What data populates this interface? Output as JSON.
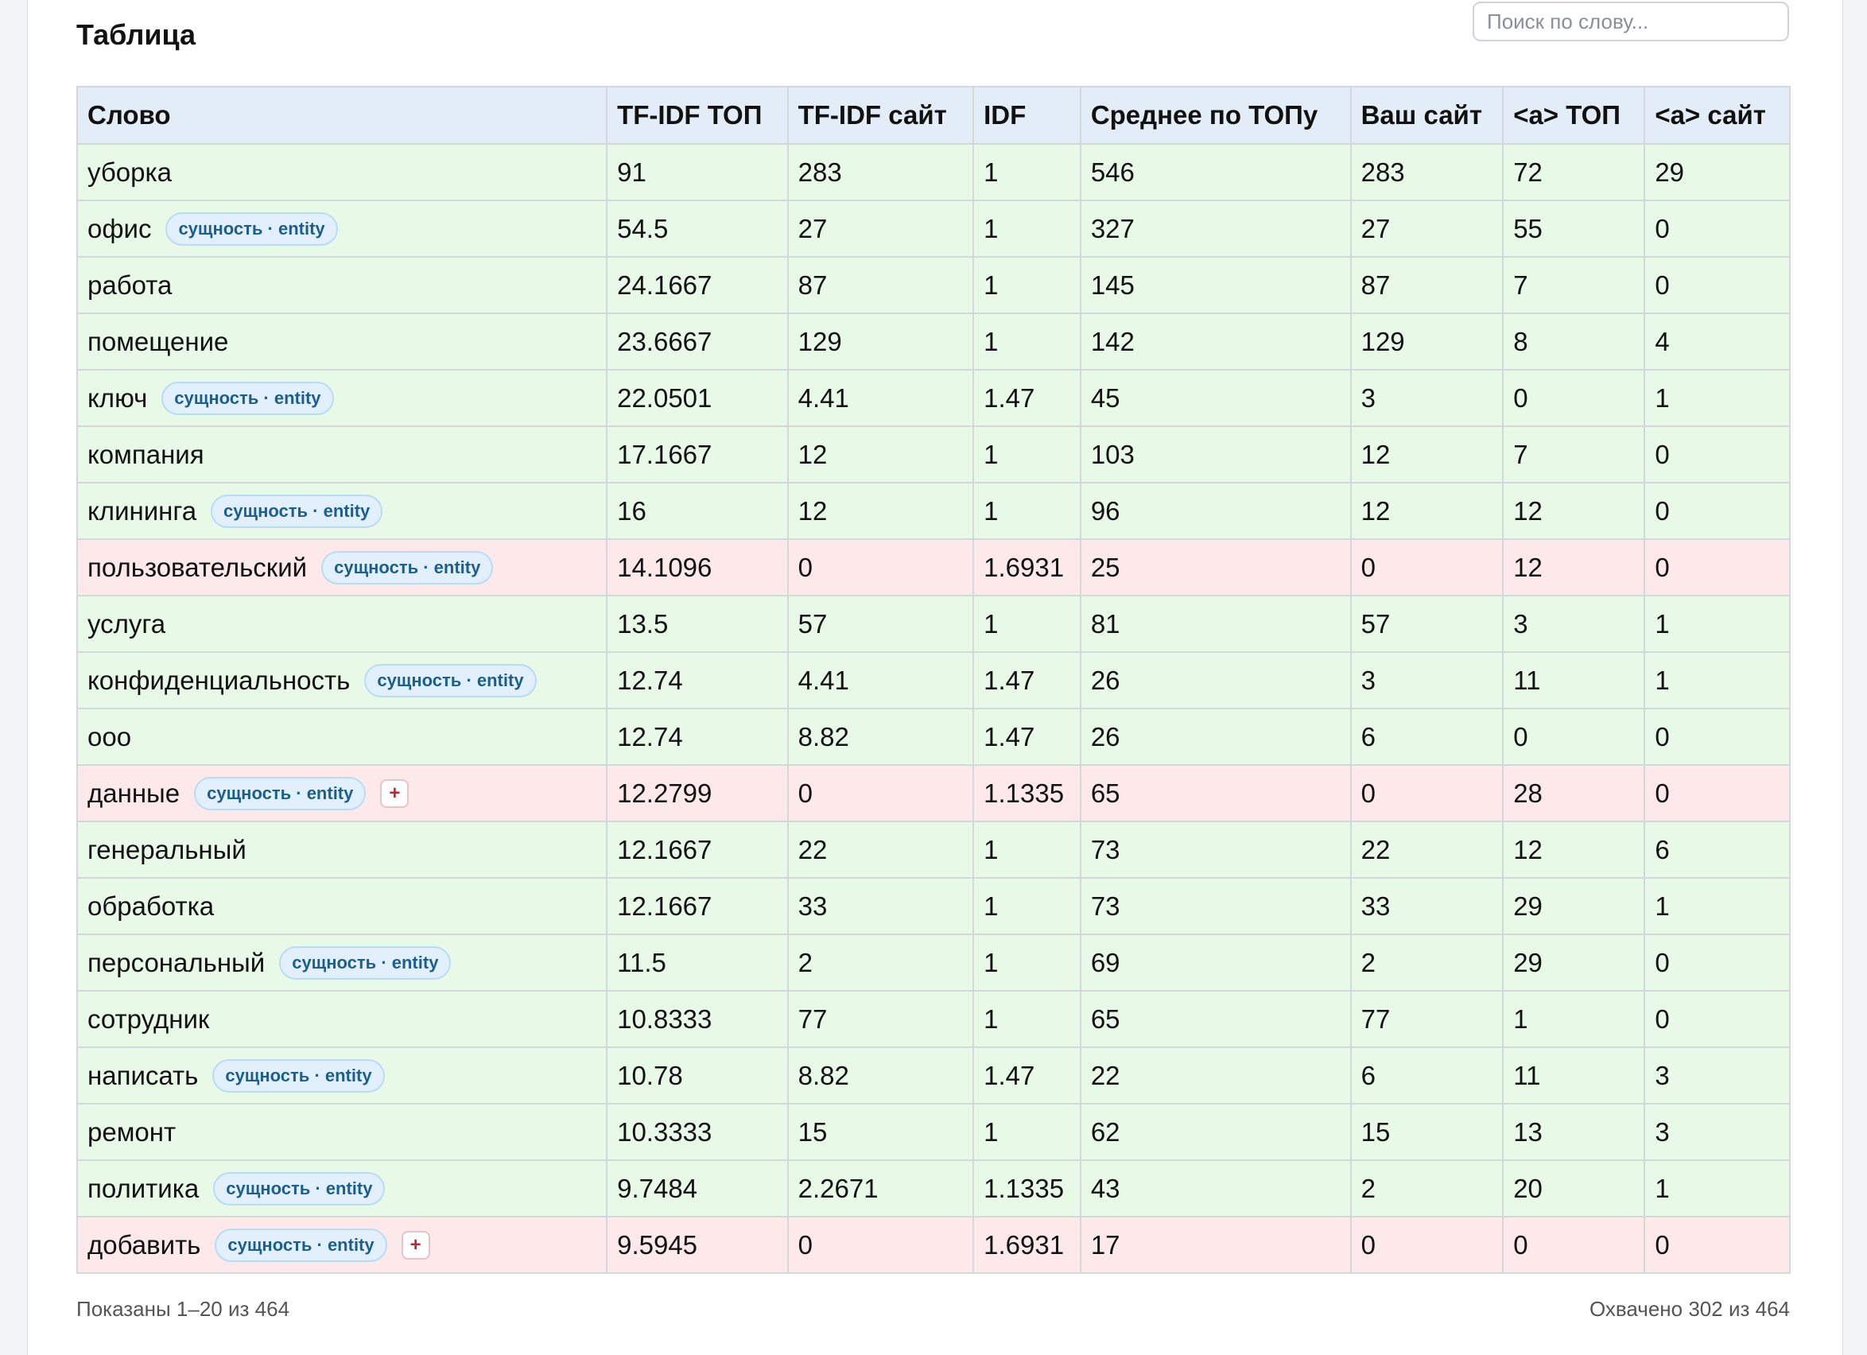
{
  "title": "Таблица",
  "search": {
    "placeholder": "Поиск по слову..."
  },
  "columns": [
    "Слово",
    "TF-IDF ТОП",
    "TF-IDF сайт",
    "IDF",
    "Среднее по ТОПу",
    "Ваш сайт",
    "<a> ТОП",
    "<a> сайт"
  ],
  "badge_label": "сущность · entity",
  "plus_label": "+",
  "rows": [
    {
      "word": "уборка",
      "entity": false,
      "plus": false,
      "status": "ok",
      "cells": [
        "91",
        "283",
        "1",
        "546",
        "283",
        "72",
        "29"
      ]
    },
    {
      "word": "офис",
      "entity": true,
      "plus": false,
      "status": "ok",
      "cells": [
        "54.5",
        "27",
        "1",
        "327",
        "27",
        "55",
        "0"
      ]
    },
    {
      "word": "работа",
      "entity": false,
      "plus": false,
      "status": "ok",
      "cells": [
        "24.1667",
        "87",
        "1",
        "145",
        "87",
        "7",
        "0"
      ]
    },
    {
      "word": "помещение",
      "entity": false,
      "plus": false,
      "status": "ok",
      "cells": [
        "23.6667",
        "129",
        "1",
        "142",
        "129",
        "8",
        "4"
      ]
    },
    {
      "word": "ключ",
      "entity": true,
      "plus": false,
      "status": "ok",
      "cells": [
        "22.0501",
        "4.41",
        "1.47",
        "45",
        "3",
        "0",
        "1"
      ]
    },
    {
      "word": "компания",
      "entity": false,
      "plus": false,
      "status": "ok",
      "cells": [
        "17.1667",
        "12",
        "1",
        "103",
        "12",
        "7",
        "0"
      ]
    },
    {
      "word": "клининга",
      "entity": true,
      "plus": false,
      "status": "ok",
      "cells": [
        "16",
        "12",
        "1",
        "96",
        "12",
        "12",
        "0"
      ]
    },
    {
      "word": "пользовательский",
      "entity": true,
      "plus": false,
      "status": "miss",
      "cells": [
        "14.1096",
        "0",
        "1.6931",
        "25",
        "0",
        "12",
        "0"
      ]
    },
    {
      "word": "услуга",
      "entity": false,
      "plus": false,
      "status": "ok",
      "cells": [
        "13.5",
        "57",
        "1",
        "81",
        "57",
        "3",
        "1"
      ]
    },
    {
      "word": "конфиденциальность",
      "entity": true,
      "plus": false,
      "status": "ok",
      "cells": [
        "12.74",
        "4.41",
        "1.47",
        "26",
        "3",
        "11",
        "1"
      ]
    },
    {
      "word": "ооо",
      "entity": false,
      "plus": false,
      "status": "ok",
      "cells": [
        "12.74",
        "8.82",
        "1.47",
        "26",
        "6",
        "0",
        "0"
      ]
    },
    {
      "word": "данные",
      "entity": true,
      "plus": true,
      "status": "miss",
      "cells": [
        "12.2799",
        "0",
        "1.1335",
        "65",
        "0",
        "28",
        "0"
      ]
    },
    {
      "word": "генеральный",
      "entity": false,
      "plus": false,
      "status": "ok",
      "cells": [
        "12.1667",
        "22",
        "1",
        "73",
        "22",
        "12",
        "6"
      ]
    },
    {
      "word": "обработка",
      "entity": false,
      "plus": false,
      "status": "ok",
      "cells": [
        "12.1667",
        "33",
        "1",
        "73",
        "33",
        "29",
        "1"
      ]
    },
    {
      "word": "персональный",
      "entity": true,
      "plus": false,
      "status": "ok",
      "cells": [
        "11.5",
        "2",
        "1",
        "69",
        "2",
        "29",
        "0"
      ]
    },
    {
      "word": "сотрудник",
      "entity": false,
      "plus": false,
      "status": "ok",
      "cells": [
        "10.8333",
        "77",
        "1",
        "65",
        "77",
        "1",
        "0"
      ]
    },
    {
      "word": "написать",
      "entity": true,
      "plus": false,
      "status": "ok",
      "cells": [
        "10.78",
        "8.82",
        "1.47",
        "22",
        "6",
        "11",
        "3"
      ]
    },
    {
      "word": "ремонт",
      "entity": false,
      "plus": false,
      "status": "ok",
      "cells": [
        "10.3333",
        "15",
        "1",
        "62",
        "15",
        "13",
        "3"
      ]
    },
    {
      "word": "политика",
      "entity": true,
      "plus": false,
      "status": "ok",
      "cells": [
        "9.7484",
        "2.2671",
        "1.1335",
        "43",
        "2",
        "20",
        "1"
      ]
    },
    {
      "word": "добавить",
      "entity": true,
      "plus": true,
      "status": "miss",
      "cells": [
        "9.5945",
        "0",
        "1.6931",
        "17",
        "0",
        "0",
        "0"
      ]
    }
  ],
  "footer": {
    "shown": "Показаны 1–20 из 464",
    "coverage": "Охвачено 302 из 464"
  },
  "colors": {
    "row_ok": "#e8f9e8",
    "row_missing": "#fde8ea",
    "header_bg": "#e3edf7",
    "badge_text": "#1d5f8a",
    "plus_text": "#c0262d"
  }
}
